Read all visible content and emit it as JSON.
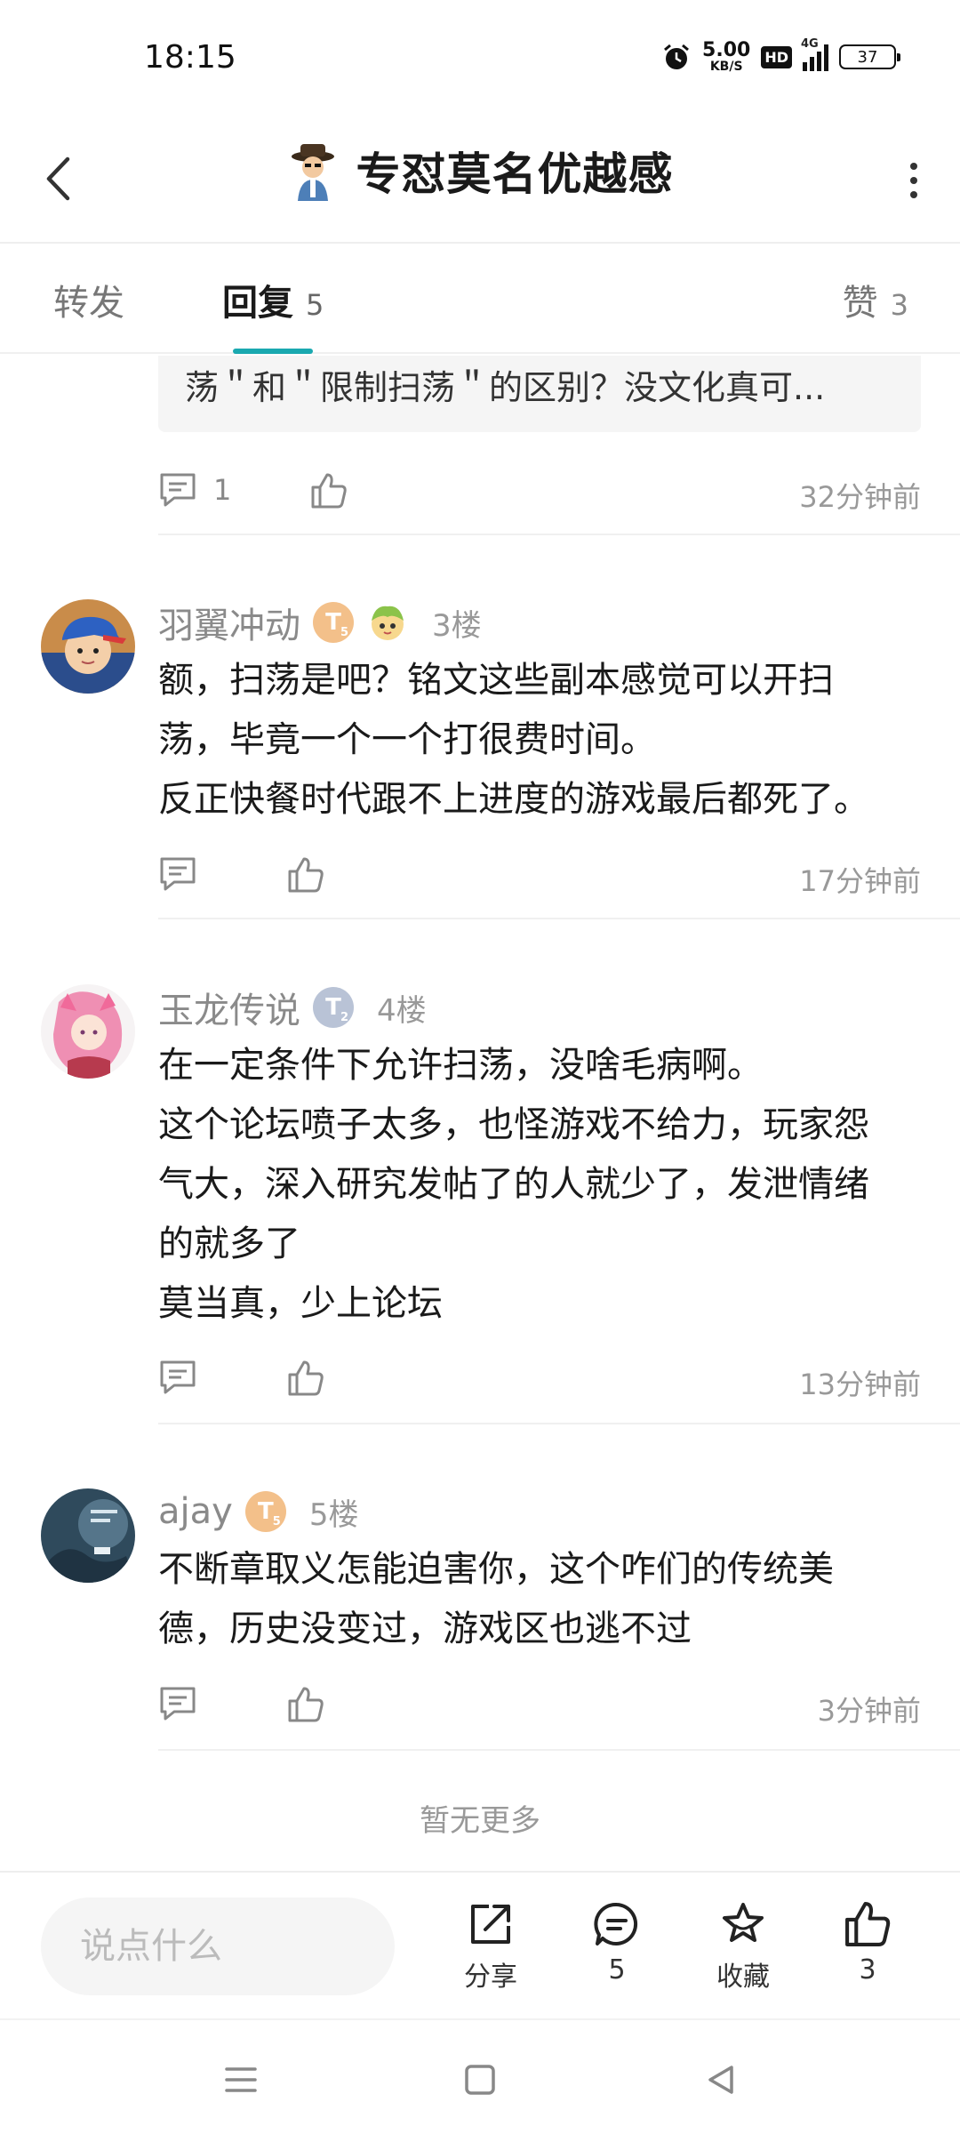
{
  "status": {
    "time": "18:15",
    "net_speed": "5.00",
    "net_unit": "KB/S",
    "hd": "HD",
    "network": "4G",
    "battery": "37"
  },
  "header": {
    "title": "专怼莫名优越感"
  },
  "tabs": [
    {
      "label": "转发",
      "count": ""
    },
    {
      "label": "回复",
      "count": "5"
    },
    {
      "label": "赞",
      "count": "3"
    }
  ],
  "top_item": {
    "quote": "荡＂和＂限制扫荡＂的区别？没文化真可...",
    "comment_count": "1",
    "time": "32分钟前"
  },
  "posts": [
    {
      "user": "羽翼冲动",
      "floor": "3楼",
      "lines": [
        "额，扫荡是吧？铭文这些副本感觉可以开扫",
        "荡，毕竟一个一个打很费时间。",
        "反正快餐时代跟不上进度的游戏最后都死了。"
      ],
      "time": "17分钟前"
    },
    {
      "user": "玉龙传说",
      "floor": "4楼",
      "lines": [
        "在一定条件下允许扫荡，没啥毛病啊。",
        "这个论坛喷子太多，也怪游戏不给力，玩家怨",
        "气大，深入研究发帖了的人就少了，发泄情绪",
        "的就多了",
        "莫当真，少上论坛"
      ],
      "time": "13分钟前"
    },
    {
      "user": "ajay",
      "floor": "5楼",
      "lines": [
        "不断章取义怎能迫害你，这个咋们的传统美",
        "德，历史没变过，游戏区也逃不过"
      ],
      "time": "3分钟前"
    }
  ],
  "no_more": "暂无更多",
  "bottom": {
    "input_placeholder": "说点什么",
    "share": "分享",
    "comments": "5",
    "favorite": "收藏",
    "likes": "3"
  },
  "colors": {
    "accent": "#1aa9b0",
    "level_gold": "#f3c08a",
    "level_silver": "#b9c3d6"
  }
}
